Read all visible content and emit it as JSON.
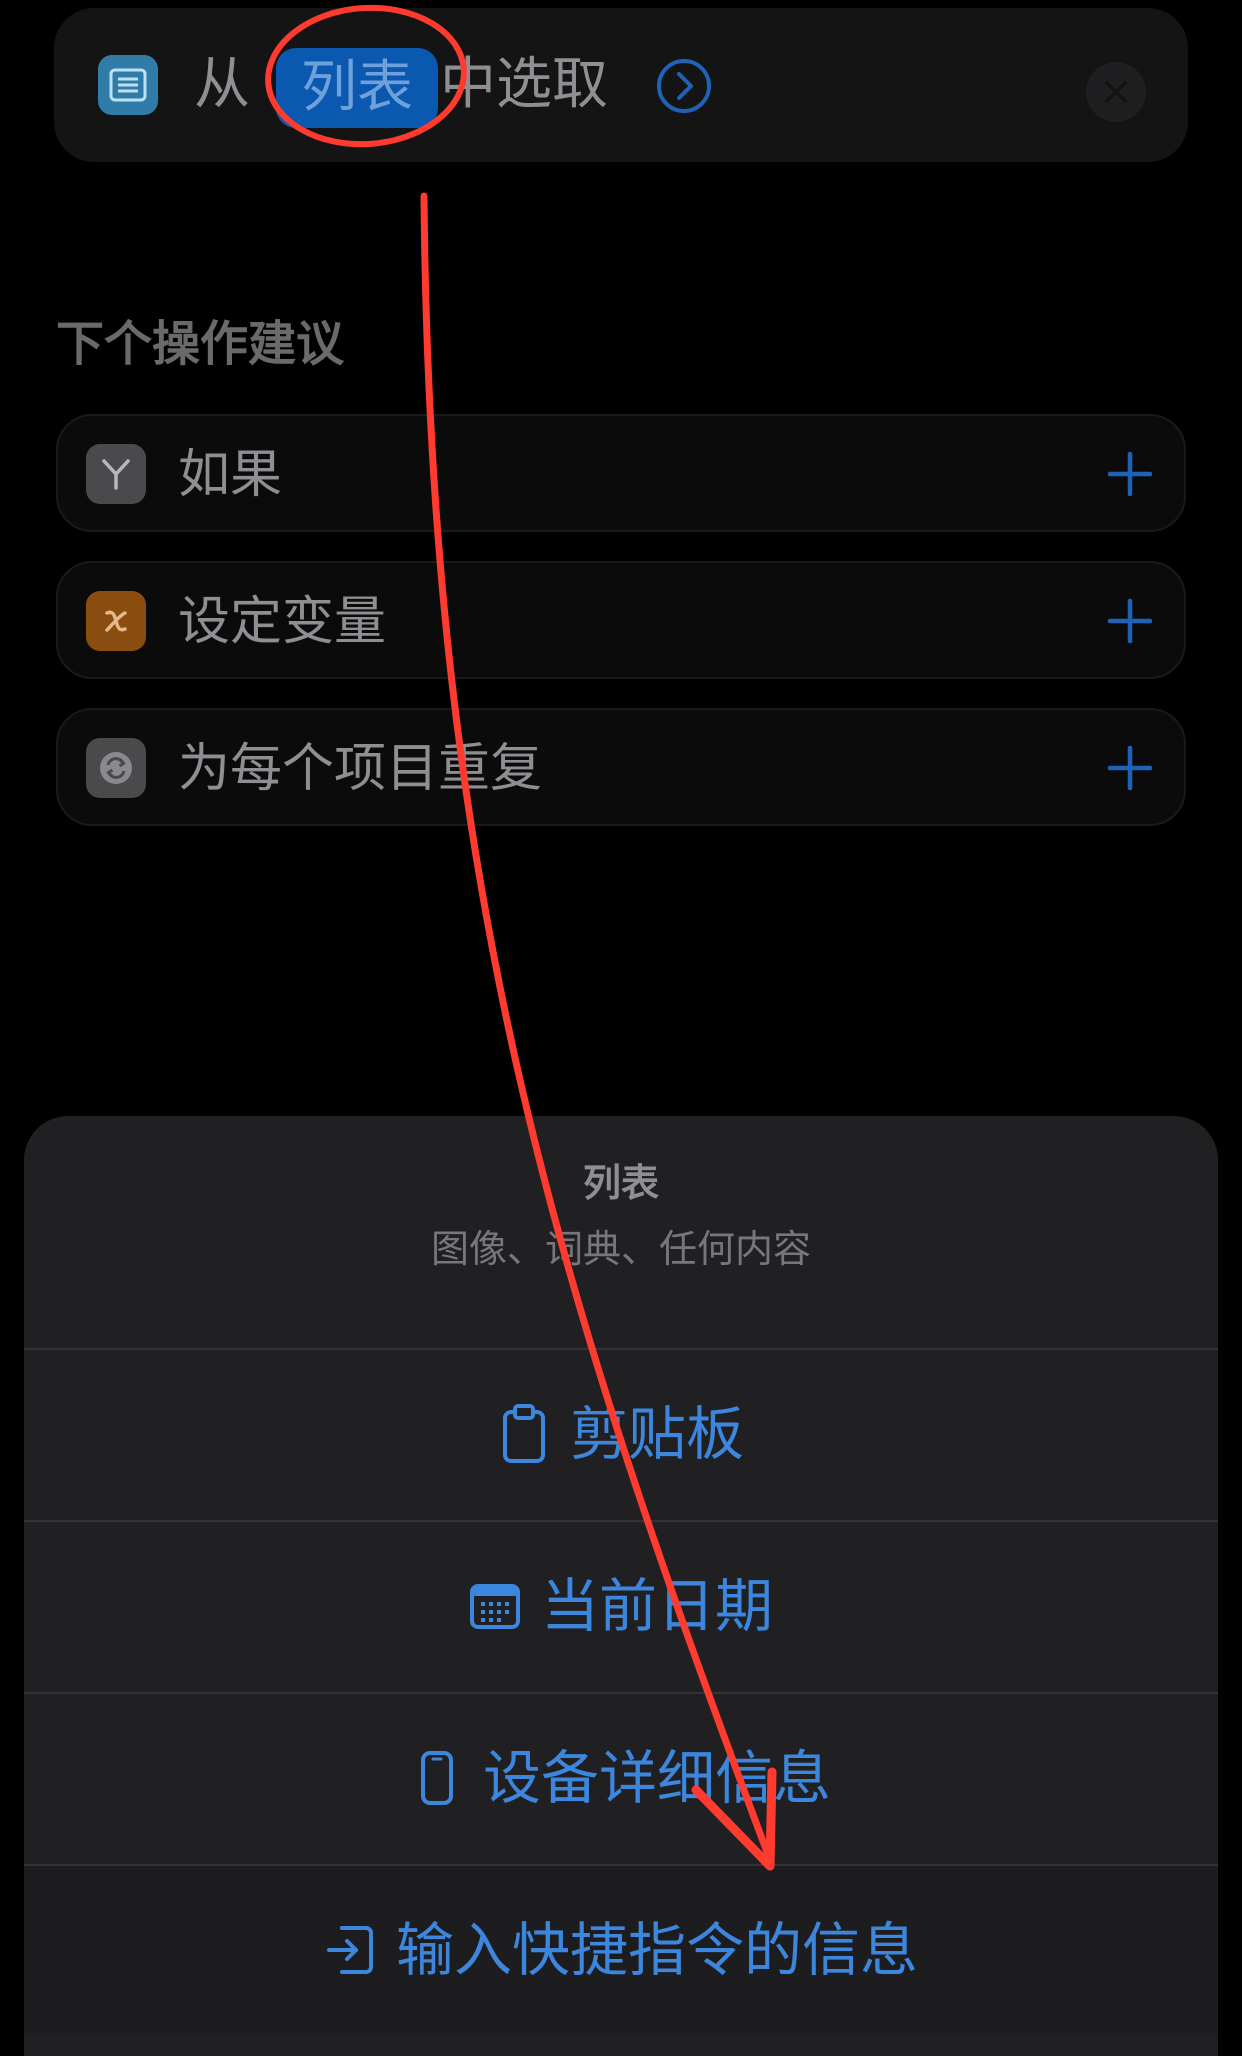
{
  "action": {
    "prefix": "从",
    "token": "列表",
    "suffix": "中选取",
    "app_icon": "list-icon",
    "expand_icon": "chevron-right-circle-icon",
    "remove_icon": "close-icon"
  },
  "suggestions": {
    "heading": "下个操作建议",
    "items": [
      {
        "label": "如果",
        "icon": "fork-icon",
        "color": "#4a4a4d"
      },
      {
        "label": "设定变量",
        "icon": "variable-x-icon",
        "color": "#8a4d10"
      },
      {
        "label": "为每个项目重复",
        "icon": "repeat-icon",
        "color": "#4a4a4d"
      }
    ]
  },
  "picker": {
    "title": "列表",
    "subtitle": "图像、词典、任何内容",
    "options": [
      {
        "label": "剪贴板",
        "icon": "clipboard-icon"
      },
      {
        "label": "当前日期",
        "icon": "calendar-icon"
      },
      {
        "label": "设备详细信息",
        "icon": "phone-icon"
      },
      {
        "label": "输入快捷指令的信息",
        "icon": "shortcut-input-icon"
      }
    ]
  },
  "colors": {
    "accent": "#3c86de",
    "token_bg": "#0b58b0",
    "annotation": "#ff3b30"
  }
}
